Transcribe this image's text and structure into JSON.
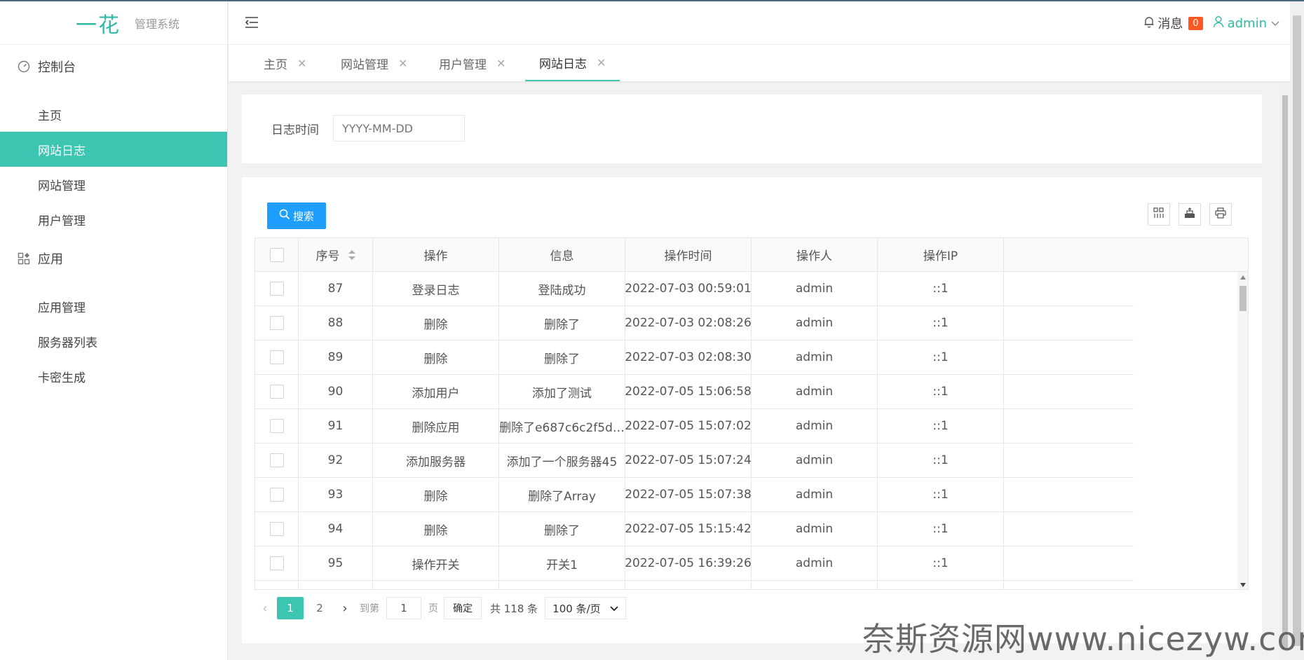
{
  "app": {
    "brand": "一花",
    "subtitle": "管理系统"
  },
  "sidebar": {
    "groups": [
      {
        "label": "控制台",
        "icon": "dashboard-icon",
        "items": [
          "主页",
          "网站日志",
          "网站管理",
          "用户管理"
        ]
      },
      {
        "label": "应用",
        "icon": "apps-icon",
        "items": [
          "应用管理",
          "服务器列表",
          "卡密生成"
        ]
      }
    ],
    "active_item": "网站日志"
  },
  "header": {
    "messages_label": "消息",
    "messages_count": "0",
    "user": "admin"
  },
  "tabs": [
    {
      "label": "主页",
      "active": false
    },
    {
      "label": "网站管理",
      "active": false
    },
    {
      "label": "用户管理",
      "active": false
    },
    {
      "label": "网站日志",
      "active": true
    }
  ],
  "filter": {
    "label": "日志时间",
    "placeholder": "YYYY-MM-DD"
  },
  "toolbar": {
    "search_label": "搜索"
  },
  "table": {
    "columns": [
      "序号",
      "操作",
      "信息",
      "操作时间",
      "操作人",
      "操作IP"
    ],
    "rows": [
      [
        "87",
        "登录日志",
        "登陆成功",
        "2022-07-03 00:59:01",
        "admin",
        "::1"
      ],
      [
        "88",
        "删除",
        "删除了",
        "2022-07-03 02:08:26",
        "admin",
        "::1"
      ],
      [
        "89",
        "删除",
        "删除了",
        "2022-07-03 02:08:30",
        "admin",
        "::1"
      ],
      [
        "90",
        "添加用户",
        "添加了测试",
        "2022-07-05 15:06:58",
        "admin",
        "::1"
      ],
      [
        "91",
        "删除应用",
        "删除了e687c6c2f5d…",
        "2022-07-05 15:07:02",
        "admin",
        "::1"
      ],
      [
        "92",
        "添加服务器",
        "添加了一个服务器45",
        "2022-07-05 15:07:24",
        "admin",
        "::1"
      ],
      [
        "93",
        "删除",
        "删除了Array",
        "2022-07-05 15:07:38",
        "admin",
        "::1"
      ],
      [
        "94",
        "删除",
        "删除了",
        "2022-07-05 15:15:42",
        "admin",
        "::1"
      ],
      [
        "95",
        "操作开关",
        "开关1",
        "2022-07-05 16:39:26",
        "admin",
        "::1"
      ]
    ]
  },
  "pagination": {
    "pages": [
      "1",
      "2"
    ],
    "current": "1",
    "goto_label": "到第",
    "goto_value": "1",
    "page_label": "页",
    "confirm": "确定",
    "total": "共 118 条",
    "page_size": "100 条/页"
  },
  "watermark": "奈斯资源网www.nicezyw.com"
}
